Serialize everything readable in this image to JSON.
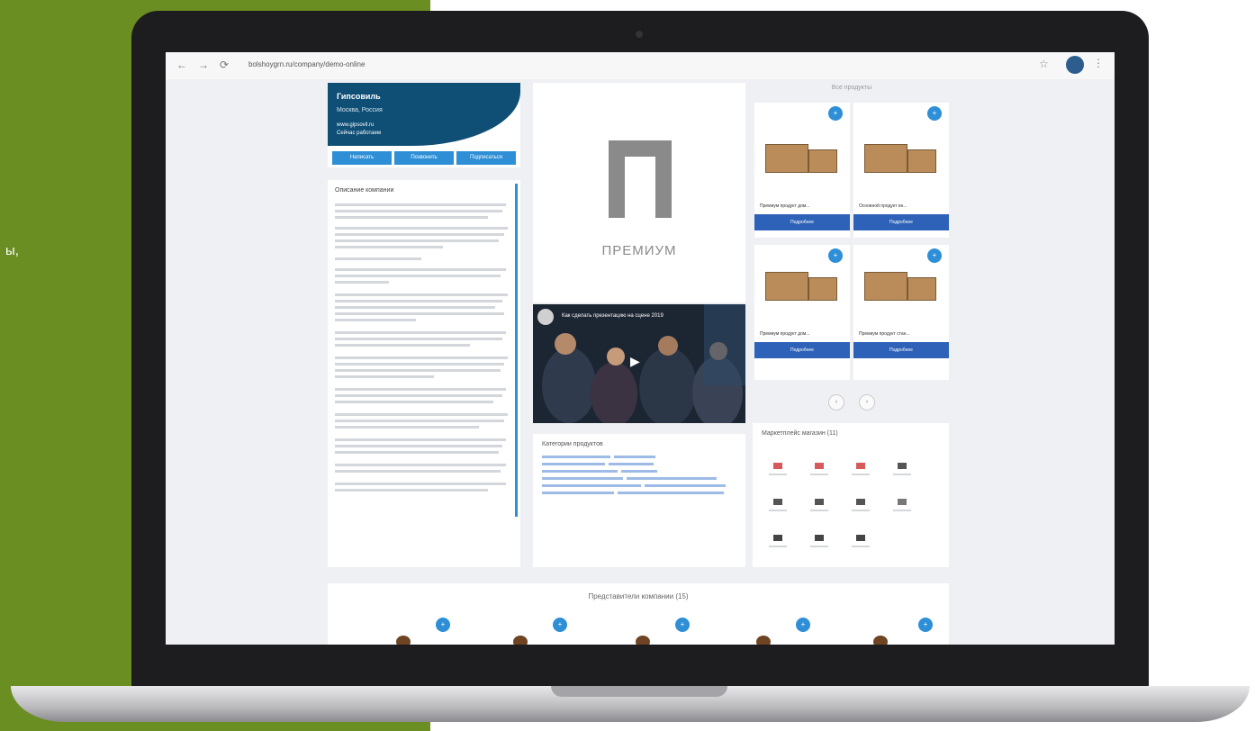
{
  "side_text": "ы,",
  "browser": {
    "url": "bolshoygrn.ru/company/demo-online",
    "back": "←",
    "forward": "→",
    "reload": "⟳",
    "star": "☆",
    "menu": "⋮"
  },
  "profile": {
    "name": "Гипсовиль",
    "city": "Москва, Россия",
    "link": "www.gipsovil.ru",
    "hours": "Сейчас работаем",
    "actions": [
      "Написать",
      "Позвонить",
      "Подписаться"
    ]
  },
  "description": {
    "title": "Описание компании"
  },
  "logo": {
    "text": "ПРЕМИУМ"
  },
  "video": {
    "title": "Как сделать презентацию на сцене 2019",
    "play": "▶"
  },
  "categories": {
    "title": "Категории продуктов"
  },
  "products": {
    "title": "Все продукты",
    "badge": "+",
    "items": [
      {
        "name": "Премиум продукт дом...",
        "button": "Подробнее"
      },
      {
        "name": "Основной продукт ин...",
        "button": "Подробнее"
      },
      {
        "name": "Премиум продукт дом...",
        "button": "Подробнее"
      },
      {
        "name": "Премиум продукт стан...",
        "button": "Подробнее"
      }
    ],
    "prev": "‹",
    "next": "›"
  },
  "market": {
    "title": "Маркетплейс магазин (11)"
  },
  "reps": {
    "title": "Представители компании (15)",
    "badge": "+"
  },
  "colors": {
    "green": "#6b8e23",
    "navy": "#0f4f75",
    "blue": "#2e8fd6",
    "button_blue": "#2e62b8"
  }
}
